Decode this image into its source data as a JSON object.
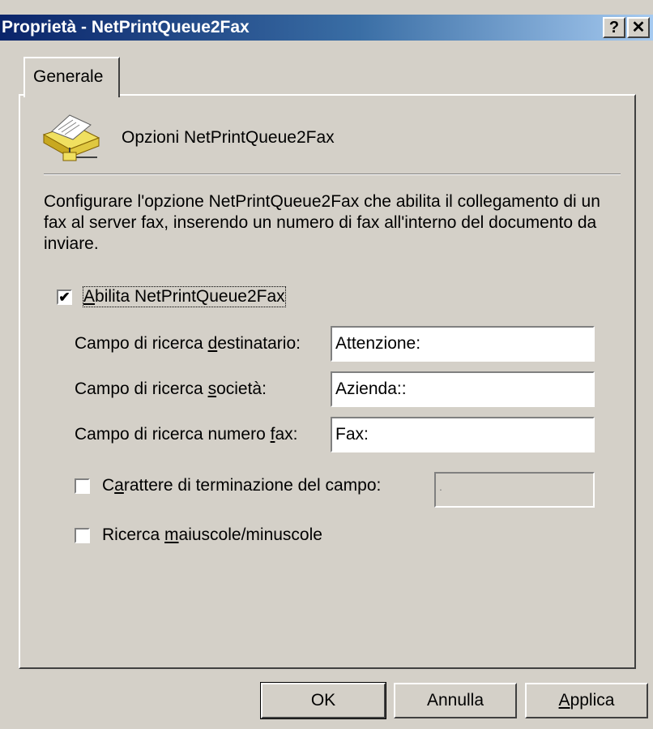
{
  "window": {
    "title": "Proprietà - NetPrintQueue2Fax",
    "help_button": "?",
    "close_button": "✕"
  },
  "tabs": [
    {
      "label": "Generale"
    }
  ],
  "header": {
    "icon": "printer-fax-icon",
    "title": "Opzioni NetPrintQueue2Fax"
  },
  "description": "Configurare l'opzione NetPrintQueue2Fax che abilita il collegamento di un fax al server fax, inserendo un numero di fax all'interno del documento da inviare.",
  "enable": {
    "label_accel": "A",
    "label_rest": "bilita NetPrintQueue2Fax",
    "checked": true
  },
  "fields": [
    {
      "label_pre": "Campo di ricerca ",
      "label_accel": "d",
      "label_post": "estinatario:",
      "value": "Attenzione:"
    },
    {
      "label_pre": "Campo di ricerca ",
      "label_accel": "s",
      "label_post": "ocietà:",
      "value": "Azienda::"
    },
    {
      "label_pre": "Campo di ricerca numero ",
      "label_accel": "f",
      "label_post": "ax:",
      "value": "Fax:"
    }
  ],
  "terminator": {
    "label_pre": "C",
    "label_accel": "a",
    "label_post": "rattere di terminazione del campo:",
    "checked": false,
    "value": "."
  },
  "case_sensitive": {
    "label_pre": "Ricerca ",
    "label_accel": "m",
    "label_post": "aiuscole/minuscole",
    "checked": false
  },
  "buttons": {
    "ok": "OK",
    "cancel": "Annulla",
    "apply_accel": "A",
    "apply_rest": "pplica"
  }
}
